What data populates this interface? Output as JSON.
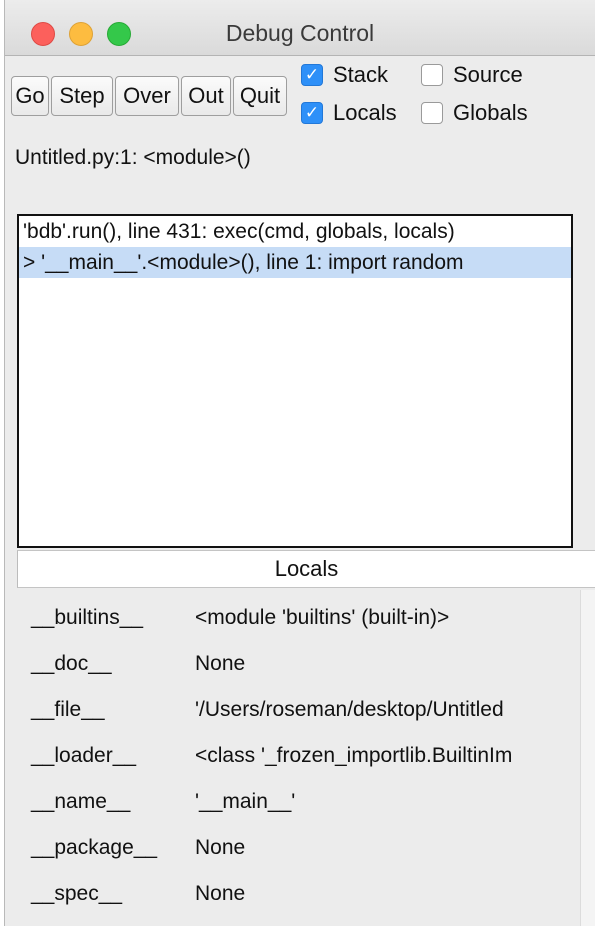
{
  "window": {
    "title": "Debug Control"
  },
  "toolbar": {
    "buttons": [
      "Go",
      "Step",
      "Over",
      "Out",
      "Quit"
    ],
    "checkboxes": [
      {
        "label": "Stack",
        "checked": true
      },
      {
        "label": "Source",
        "checked": false
      },
      {
        "label": "Locals",
        "checked": true
      },
      {
        "label": "Globals",
        "checked": false
      }
    ]
  },
  "status": "Untitled.py:1: <module>()",
  "stack": [
    "'bdb'.run(), line 431: exec(cmd, globals, locals)",
    "> '__main__'.<module>(), line 1: import random"
  ],
  "locals": {
    "header": "Locals",
    "rows": [
      {
        "name": "__builtins__",
        "value": "<module 'builtins' (built-in)>"
      },
      {
        "name": "__doc__",
        "value": "None"
      },
      {
        "name": "__file__",
        "value": "'/Users/roseman/desktop/Untitled"
      },
      {
        "name": "__loader__",
        "value": "<class '_frozen_importlib.BuiltinIm"
      },
      {
        "name": "__name__",
        "value": "'__main__'"
      },
      {
        "name": "__package__",
        "value": "None"
      },
      {
        "name": "__spec__",
        "value": "None"
      }
    ]
  },
  "colors": {
    "close": "#fc605c",
    "minimize": "#fdbc40",
    "maximize": "#34c84a",
    "checkbox_on": "#2e90f8",
    "selection": "#c6dcf6"
  }
}
